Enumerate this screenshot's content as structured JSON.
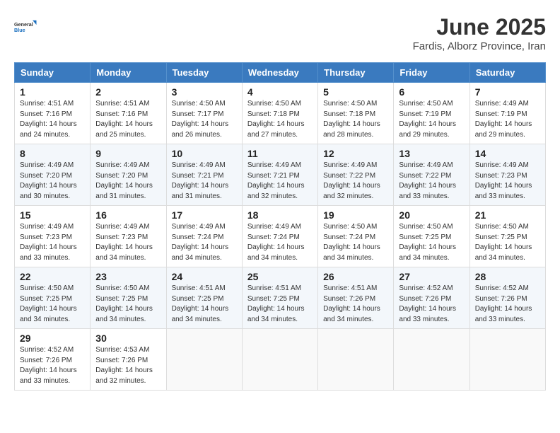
{
  "logo": {
    "line1": "General",
    "line2": "Blue"
  },
  "title": "June 2025",
  "location": "Fardis, Alborz Province, Iran",
  "days_of_week": [
    "Sunday",
    "Monday",
    "Tuesday",
    "Wednesday",
    "Thursday",
    "Friday",
    "Saturday"
  ],
  "weeks": [
    [
      {
        "day": "1",
        "sunrise": "4:51 AM",
        "sunset": "7:16 PM",
        "daylight": "14 hours and 24 minutes."
      },
      {
        "day": "2",
        "sunrise": "4:51 AM",
        "sunset": "7:16 PM",
        "daylight": "14 hours and 25 minutes."
      },
      {
        "day": "3",
        "sunrise": "4:50 AM",
        "sunset": "7:17 PM",
        "daylight": "14 hours and 26 minutes."
      },
      {
        "day": "4",
        "sunrise": "4:50 AM",
        "sunset": "7:18 PM",
        "daylight": "14 hours and 27 minutes."
      },
      {
        "day": "5",
        "sunrise": "4:50 AM",
        "sunset": "7:18 PM",
        "daylight": "14 hours and 28 minutes."
      },
      {
        "day": "6",
        "sunrise": "4:50 AM",
        "sunset": "7:19 PM",
        "daylight": "14 hours and 29 minutes."
      },
      {
        "day": "7",
        "sunrise": "4:49 AM",
        "sunset": "7:19 PM",
        "daylight": "14 hours and 29 minutes."
      }
    ],
    [
      {
        "day": "8",
        "sunrise": "4:49 AM",
        "sunset": "7:20 PM",
        "daylight": "14 hours and 30 minutes."
      },
      {
        "day": "9",
        "sunrise": "4:49 AM",
        "sunset": "7:20 PM",
        "daylight": "14 hours and 31 minutes."
      },
      {
        "day": "10",
        "sunrise": "4:49 AM",
        "sunset": "7:21 PM",
        "daylight": "14 hours and 31 minutes."
      },
      {
        "day": "11",
        "sunrise": "4:49 AM",
        "sunset": "7:21 PM",
        "daylight": "14 hours and 32 minutes."
      },
      {
        "day": "12",
        "sunrise": "4:49 AM",
        "sunset": "7:22 PM",
        "daylight": "14 hours and 32 minutes."
      },
      {
        "day": "13",
        "sunrise": "4:49 AM",
        "sunset": "7:22 PM",
        "daylight": "14 hours and 33 minutes."
      },
      {
        "day": "14",
        "sunrise": "4:49 AM",
        "sunset": "7:23 PM",
        "daylight": "14 hours and 33 minutes."
      }
    ],
    [
      {
        "day": "15",
        "sunrise": "4:49 AM",
        "sunset": "7:23 PM",
        "daylight": "14 hours and 33 minutes."
      },
      {
        "day": "16",
        "sunrise": "4:49 AM",
        "sunset": "7:23 PM",
        "daylight": "14 hours and 34 minutes."
      },
      {
        "day": "17",
        "sunrise": "4:49 AM",
        "sunset": "7:24 PM",
        "daylight": "14 hours and 34 minutes."
      },
      {
        "day": "18",
        "sunrise": "4:49 AM",
        "sunset": "7:24 PM",
        "daylight": "14 hours and 34 minutes."
      },
      {
        "day": "19",
        "sunrise": "4:50 AM",
        "sunset": "7:24 PM",
        "daylight": "14 hours and 34 minutes."
      },
      {
        "day": "20",
        "sunrise": "4:50 AM",
        "sunset": "7:25 PM",
        "daylight": "14 hours and 34 minutes."
      },
      {
        "day": "21",
        "sunrise": "4:50 AM",
        "sunset": "7:25 PM",
        "daylight": "14 hours and 34 minutes."
      }
    ],
    [
      {
        "day": "22",
        "sunrise": "4:50 AM",
        "sunset": "7:25 PM",
        "daylight": "14 hours and 34 minutes."
      },
      {
        "day": "23",
        "sunrise": "4:50 AM",
        "sunset": "7:25 PM",
        "daylight": "14 hours and 34 minutes."
      },
      {
        "day": "24",
        "sunrise": "4:51 AM",
        "sunset": "7:25 PM",
        "daylight": "14 hours and 34 minutes."
      },
      {
        "day": "25",
        "sunrise": "4:51 AM",
        "sunset": "7:25 PM",
        "daylight": "14 hours and 34 minutes."
      },
      {
        "day": "26",
        "sunrise": "4:51 AM",
        "sunset": "7:26 PM",
        "daylight": "14 hours and 34 minutes."
      },
      {
        "day": "27",
        "sunrise": "4:52 AM",
        "sunset": "7:26 PM",
        "daylight": "14 hours and 33 minutes."
      },
      {
        "day": "28",
        "sunrise": "4:52 AM",
        "sunset": "7:26 PM",
        "daylight": "14 hours and 33 minutes."
      }
    ],
    [
      {
        "day": "29",
        "sunrise": "4:52 AM",
        "sunset": "7:26 PM",
        "daylight": "14 hours and 33 minutes."
      },
      {
        "day": "30",
        "sunrise": "4:53 AM",
        "sunset": "7:26 PM",
        "daylight": "14 hours and 32 minutes."
      },
      null,
      null,
      null,
      null,
      null
    ]
  ],
  "labels": {
    "sunrise": "Sunrise: ",
    "sunset": "Sunset: ",
    "daylight": "Daylight: "
  }
}
